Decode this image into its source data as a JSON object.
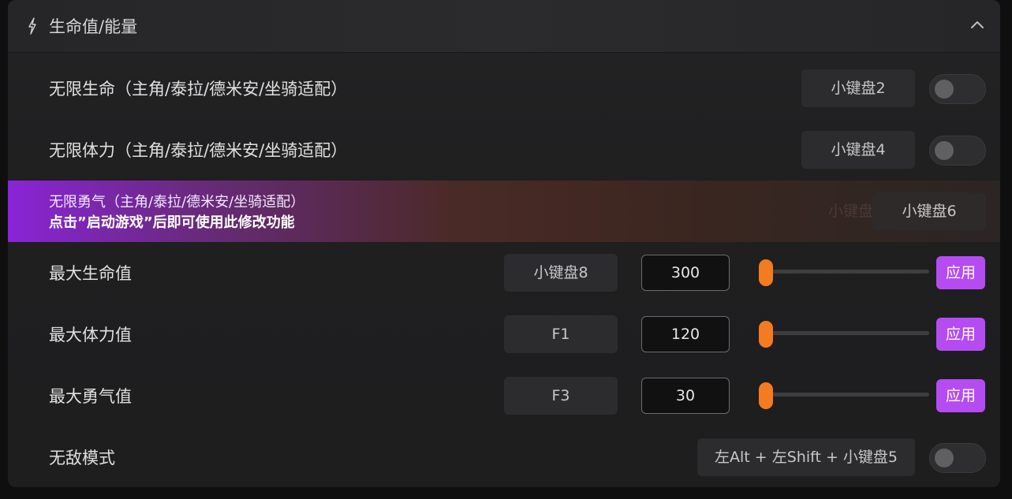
{
  "section": {
    "title": "生命值/能量",
    "icon": "bolt-icon",
    "collapse_icon": "chevron-up-icon"
  },
  "rows": {
    "infinite_health": {
      "label": "无限生命（主角/泰拉/德米安/坐骑适配）",
      "hotkey": "小键盘2",
      "enabled": false
    },
    "infinite_stamina": {
      "label": "无限体力（主角/泰拉/德米安/坐骑适配）",
      "hotkey": "小键盘4",
      "enabled": false
    },
    "infinite_courage": {
      "label": "无限勇气（主角/泰拉/德米安/坐骑适配）",
      "notice": "点击”启动游戏”后即可使用此修改功能",
      "hotkey_ghost": "小键盘6",
      "hotkey": "小键盘6"
    },
    "max_health": {
      "label": "最大生命值",
      "hotkey": "小键盘8",
      "value": "300",
      "slider_fraction": 0.0,
      "apply_label": "应用"
    },
    "max_stamina": {
      "label": "最大体力值",
      "hotkey": "F1",
      "value": "120",
      "slider_fraction": 0.0,
      "apply_label": "应用"
    },
    "max_courage": {
      "label": "最大勇气值",
      "hotkey": "F3",
      "value": "30",
      "slider_fraction": 0.0,
      "apply_label": "应用"
    },
    "god_mode": {
      "label": "无敌模式",
      "hotkey": "左Alt + 左Shift + 小键盘5",
      "enabled": false
    }
  },
  "colors": {
    "accent": "#b44cf2",
    "slider": "#f47b20",
    "promo_start": "#8a24d8"
  }
}
